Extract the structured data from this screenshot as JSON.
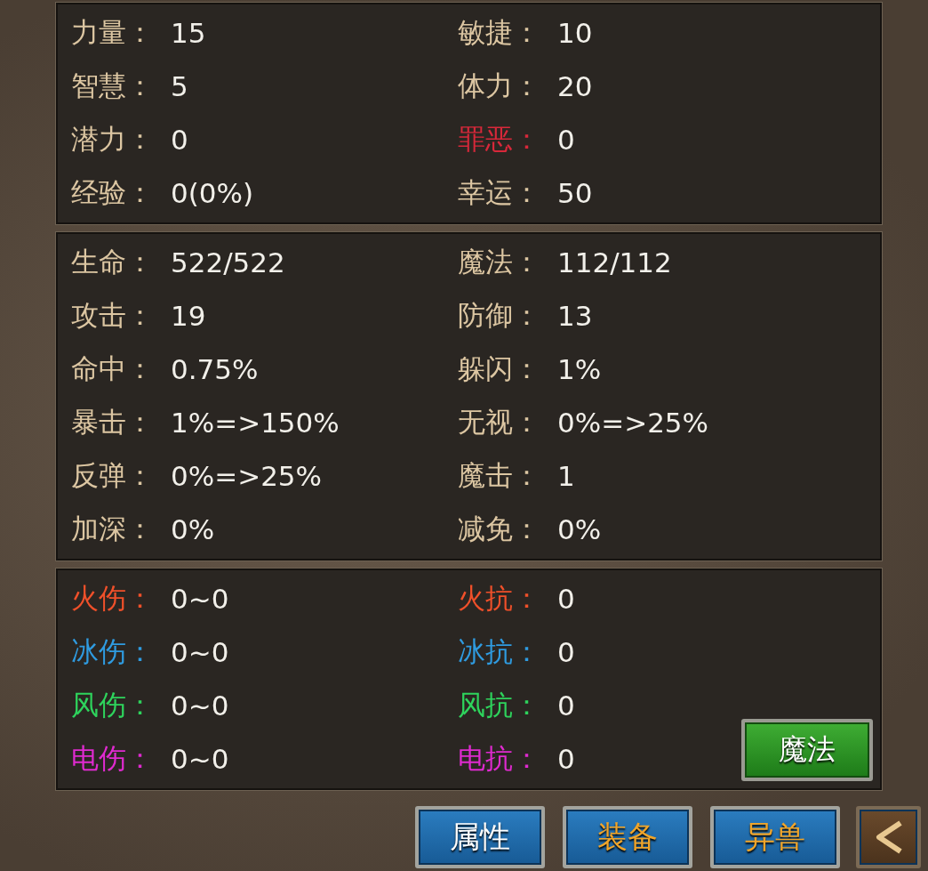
{
  "panels": [
    {
      "stats": [
        {
          "label": "力量：",
          "value": "15",
          "color": "#dcc6a2"
        },
        {
          "label": "敏捷：",
          "value": "10",
          "color": "#dcc6a2"
        },
        {
          "label": "智慧：",
          "value": "5",
          "color": "#dcc6a2"
        },
        {
          "label": "体力：",
          "value": "20",
          "color": "#dcc6a2"
        },
        {
          "label": "潜力：",
          "value": "0",
          "color": "#dcc6a2"
        },
        {
          "label": "罪恶：",
          "value": "0",
          "color": "#d8283a"
        },
        {
          "label": "经验：",
          "value": "0(0%)",
          "color": "#dcc6a2"
        },
        {
          "label": "幸运：",
          "value": "50",
          "color": "#dcc6a2"
        }
      ]
    },
    {
      "stats": [
        {
          "label": "生命：",
          "value": "522/522",
          "color": "#dcc6a2"
        },
        {
          "label": "魔法：",
          "value": "112/112",
          "color": "#dcc6a2"
        },
        {
          "label": "攻击：",
          "value": "19",
          "color": "#dcc6a2"
        },
        {
          "label": "防御：",
          "value": "13",
          "color": "#dcc6a2"
        },
        {
          "label": "命中：",
          "value": "0.75%",
          "color": "#dcc6a2"
        },
        {
          "label": "躲闪：",
          "value": "1%",
          "color": "#dcc6a2"
        },
        {
          "label": "暴击：",
          "value": "1%=>150%",
          "color": "#dcc6a2"
        },
        {
          "label": "无视：",
          "value": "0%=>25%",
          "color": "#dcc6a2"
        },
        {
          "label": "反弹：",
          "value": "0%=>25%",
          "color": "#dcc6a2"
        },
        {
          "label": "魔击：",
          "value": "1",
          "color": "#dcc6a2"
        },
        {
          "label": "加深：",
          "value": "0%",
          "color": "#dcc6a2"
        },
        {
          "label": "减免：",
          "value": "0%",
          "color": "#dcc6a2"
        }
      ]
    },
    {
      "stats": [
        {
          "label": "火伤：",
          "value": "0~0",
          "color": "#f0502a"
        },
        {
          "label": "火抗：",
          "value": "0",
          "color": "#f0502a"
        },
        {
          "label": "冰伤：",
          "value": "0~0",
          "color": "#2f9be0"
        },
        {
          "label": "冰抗：",
          "value": "0",
          "color": "#2f9be0"
        },
        {
          "label": "风伤：",
          "value": "0~0",
          "color": "#2ed35c"
        },
        {
          "label": "风抗：",
          "value": "0",
          "color": "#2ed35c"
        },
        {
          "label": "电伤：",
          "value": "0~0",
          "color": "#e02ad0"
        },
        {
          "label": "电抗：",
          "value": "0",
          "color": "#e02ad0"
        }
      ],
      "button": "魔法"
    }
  ],
  "tabs": [
    {
      "label": "属性",
      "selected": true
    },
    {
      "label": "装备",
      "selected": false
    },
    {
      "label": "异兽",
      "selected": false
    }
  ]
}
